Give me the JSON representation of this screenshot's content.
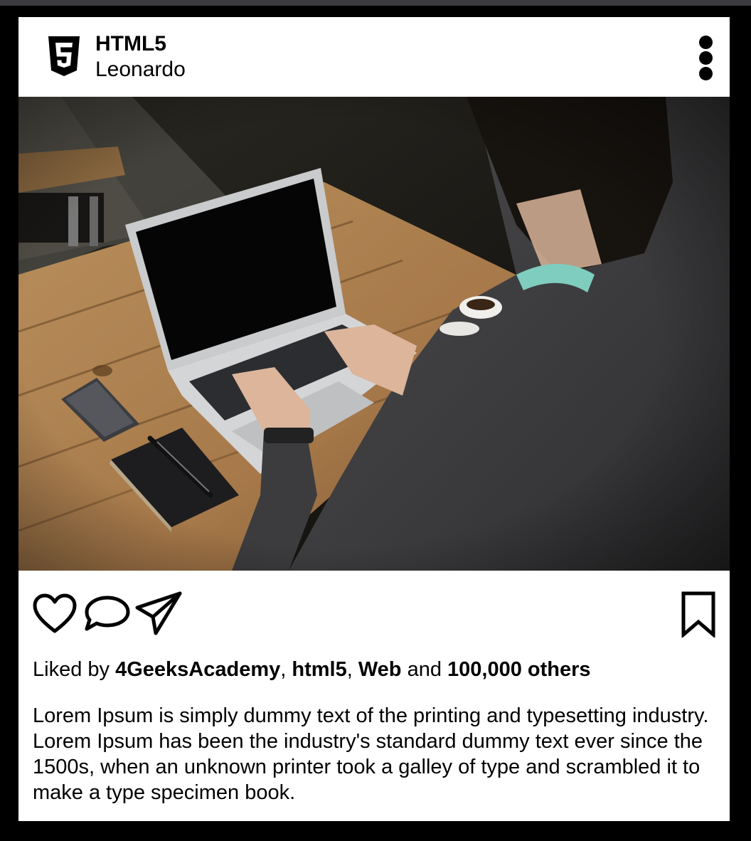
{
  "post": {
    "account_name": "HTML5",
    "account_subtitle": "Leonardo",
    "liked": {
      "prefix": "Liked by",
      "user1": "4GeeksAcademy",
      "sep1": ",",
      "user2": "html5",
      "sep2": ",",
      "user3": "Web",
      "conj": "and",
      "others": "100,000 others"
    },
    "caption": "Lorem Ipsum is simply dummy text of the printing and typesetting industry. Lorem Ipsum has been the industry's standard dummy text ever since the 1500s, when an unknown printer took a galley of type and scrambled it to make a type specimen book."
  },
  "icons": {
    "logo": "html5-logo-icon",
    "menu": "more-vertical-icon",
    "like": "heart-icon",
    "comment": "comment-icon",
    "share": "send-icon",
    "save": "bookmark-icon"
  }
}
